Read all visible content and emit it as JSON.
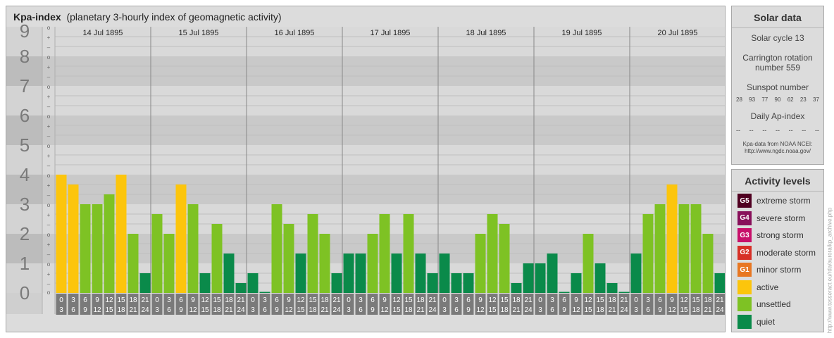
{
  "main": {
    "title_bold": "Kpa-index",
    "title_rest": "(planetary 3-hourly index of geomagnetic activity)"
  },
  "chart_data": {
    "type": "bar",
    "ylim": [
      0,
      9
    ],
    "y_ticks": [
      "0",
      "1",
      "2",
      "3",
      "4",
      "5",
      "6",
      "7",
      "8",
      "9"
    ],
    "minor_marks": [
      "o",
      "+",
      "–"
    ],
    "days": [
      "14 Jul 1895",
      "15 Jul 1895",
      "16 Jul 1895",
      "17 Jul 1895",
      "18 Jul 1895",
      "19 Jul 1895",
      "20 Jul 1895"
    ],
    "interval_labels": [
      [
        "0",
        "3"
      ],
      [
        "3",
        "6"
      ],
      [
        "6",
        "9"
      ],
      [
        "9",
        "12"
      ],
      [
        "12",
        "15"
      ],
      [
        "15",
        "18"
      ],
      [
        "18",
        "21"
      ],
      [
        "21",
        "24"
      ]
    ],
    "values": [
      [
        4.0,
        3.667,
        3.0,
        3.0,
        3.333,
        4.0,
        2.0,
        0.667
      ],
      [
        2.667,
        2.0,
        3.667,
        3.0,
        0.667,
        2.333,
        1.333,
        0.333
      ],
      [
        0.667,
        0.0,
        3.0,
        2.333,
        1.333,
        2.667,
        2.0,
        0.667
      ],
      [
        1.333,
        1.333,
        2.0,
        2.667,
        1.333,
        2.667,
        1.333,
        0.667
      ],
      [
        1.333,
        0.667,
        0.667,
        2.0,
        2.667,
        2.333,
        0.333,
        1.0
      ],
      [
        1.0,
        1.333,
        0.0,
        0.667,
        2.0,
        1.0,
        0.333,
        0.0
      ],
      [
        1.333,
        2.667,
        3.0,
        3.667,
        3.0,
        3.0,
        2.0,
        0.667
      ]
    ],
    "colors": {
      "quiet": "#0a8a4a",
      "unsettled": "#7ec224",
      "active": "#fcc50c",
      "G1": "#e87722",
      "G2": "#d73027",
      "G3": "#c8106a",
      "G4": "#88105a",
      "G5": "#500021"
    }
  },
  "solar": {
    "title": "Solar data",
    "cycle": "Solar cycle 13",
    "carrington_1": "Carrington rotation",
    "carrington_2": "number 559",
    "sunspot_title": "Sunspot number",
    "sunspots": [
      "28",
      "93",
      "77",
      "90",
      "62",
      "23",
      "37"
    ],
    "ap_title": "Daily Ap-index",
    "ap_values": [
      "--",
      "--",
      "--",
      "--",
      "--",
      "--",
      "--"
    ],
    "credit_1": "Kpa-data from NOAA NCEI:",
    "credit_2": "http://www.ngdc.noaa.gov/"
  },
  "levels": {
    "title": "Activity levels",
    "items": [
      {
        "code": "G5",
        "label": "extreme storm",
        "color": "#500021"
      },
      {
        "code": "G4",
        "label": "severe storm",
        "color": "#88105a"
      },
      {
        "code": "G3",
        "label": "strong storm",
        "color": "#c8106a"
      },
      {
        "code": "G2",
        "label": "moderate storm",
        "color": "#d73027"
      },
      {
        "code": "G1",
        "label": "minor storm",
        "color": "#e87722"
      },
      {
        "code": "",
        "label": "active",
        "color": "#fcc50c"
      },
      {
        "code": "",
        "label": "unsettled",
        "color": "#7ec224"
      },
      {
        "code": "",
        "label": "quiet",
        "color": "#0a8a4a"
      }
    ]
  },
  "watermark": "http://www.tesseract.eu/rda/aurora/kp_archive.php"
}
